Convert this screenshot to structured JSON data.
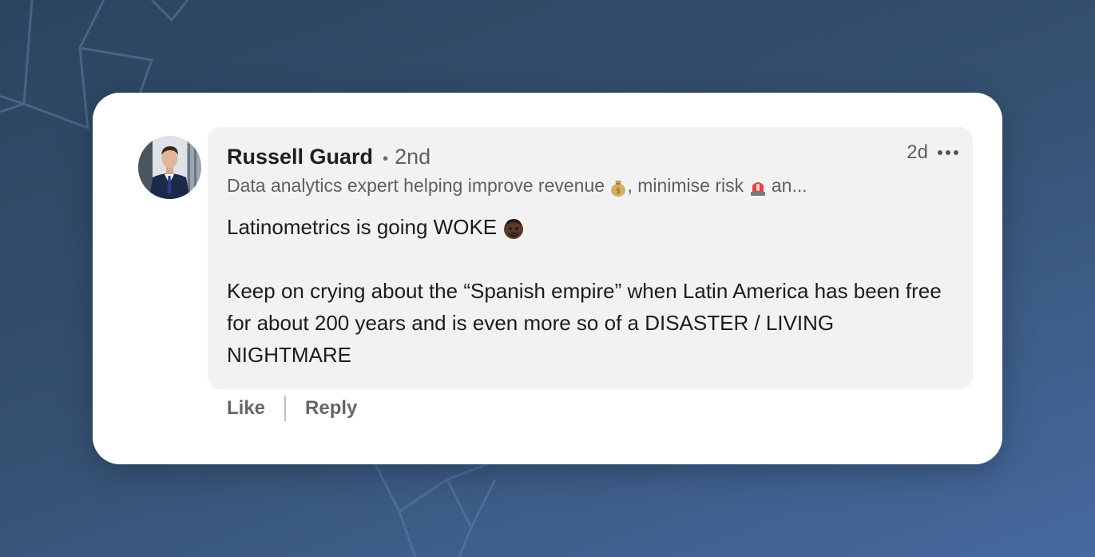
{
  "comment": {
    "author_name": "Russell Guard",
    "separator": "•",
    "connection_degree": "2nd",
    "headline_part1": "Data analytics expert helping improve revenue",
    "headline_part2": ", minimise risk",
    "headline_part3": "an...",
    "headline_emoji_1": "money-bag-icon",
    "headline_emoji_2": "siren-icon",
    "timestamp": "2d",
    "body_line_1": "Latinometrics is going WOKE",
    "body_emoji": "person-face-icon",
    "body_paragraph_2": "Keep on crying about the “Spanish empire” when Latin America has been free for about 200 years and is even more so of a DISASTER / LIVING NIGHTMARE"
  },
  "actions": {
    "like_label": "Like",
    "reply_label": "Reply"
  },
  "colors": {
    "background": "#34506f",
    "card": "#ffffff",
    "bubble": "#f2f2f2",
    "text_primary": "#1c1c1c",
    "text_secondary": "#5f5f5f"
  }
}
